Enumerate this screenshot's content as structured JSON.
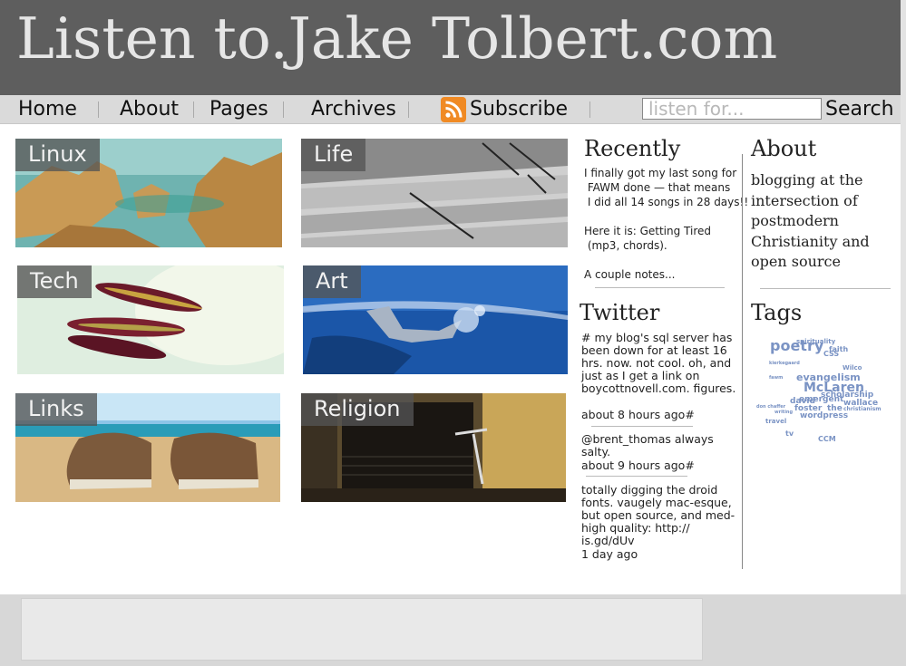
{
  "site": {
    "title": "Listen to.Jake Tolbert.com"
  },
  "nav": {
    "home": "Home",
    "about": "About",
    "pages": "Pages",
    "archives": "Archives",
    "subscribe": "Subscribe",
    "rss_icon": "rss-icon",
    "search_placeholder": "listen for...",
    "search_button": "Search"
  },
  "tiles": [
    {
      "label": "Linux"
    },
    {
      "label": "Life"
    },
    {
      "label": "Tech"
    },
    {
      "label": "Art"
    },
    {
      "label": "Links"
    },
    {
      "label": "Religion"
    }
  ],
  "recently": {
    "title": "Recently",
    "lines": [
      "I finally got my last song for",
      " FAWM done — that means",
      " I did all 14 songs in 28 days!!",
      "Here it is:  Getting Tired",
      " (mp3, chords).",
      "A couple notes..."
    ]
  },
  "twitter": {
    "title": "Twitter",
    "tweets": [
      {
        "text": "# my blog's sql server has been down for at least 16 hrs. now. not cool. oh, and just as I get a link on boycottnovell.com. figures.",
        "time": "about 8 hours ago#"
      },
      {
        "text": "@brent_thomas always salty.",
        "time": "about 9 hours ago#"
      },
      {
        "text": "totally digging the droid fonts. vaugely mac-esque, but open source, and med-high quality: http:// is.gd/dUv",
        "time": "1 day ago"
      }
    ]
  },
  "about": {
    "title": "About",
    "text": "blogging at the intersection of postmodern Christianity and open source"
  },
  "tags": {
    "title": "Tags",
    "items": [
      "poetry",
      "spirituality",
      "faith",
      "CSS",
      "kierkegaard",
      "Wilco",
      "fawm",
      "evangelism",
      "McLaren",
      "scholarship",
      "david",
      "emergent",
      "wallace",
      "foster",
      "the",
      "christianism",
      "don chaffer",
      "writing",
      "wordpress",
      "travel",
      "tv",
      "CCM"
    ]
  },
  "colors": {
    "header_bg": "#5e5e5e",
    "nav_bg": "#dadada",
    "tag_color": "#7a93c4",
    "footer_bg": "#d7d7d7"
  }
}
